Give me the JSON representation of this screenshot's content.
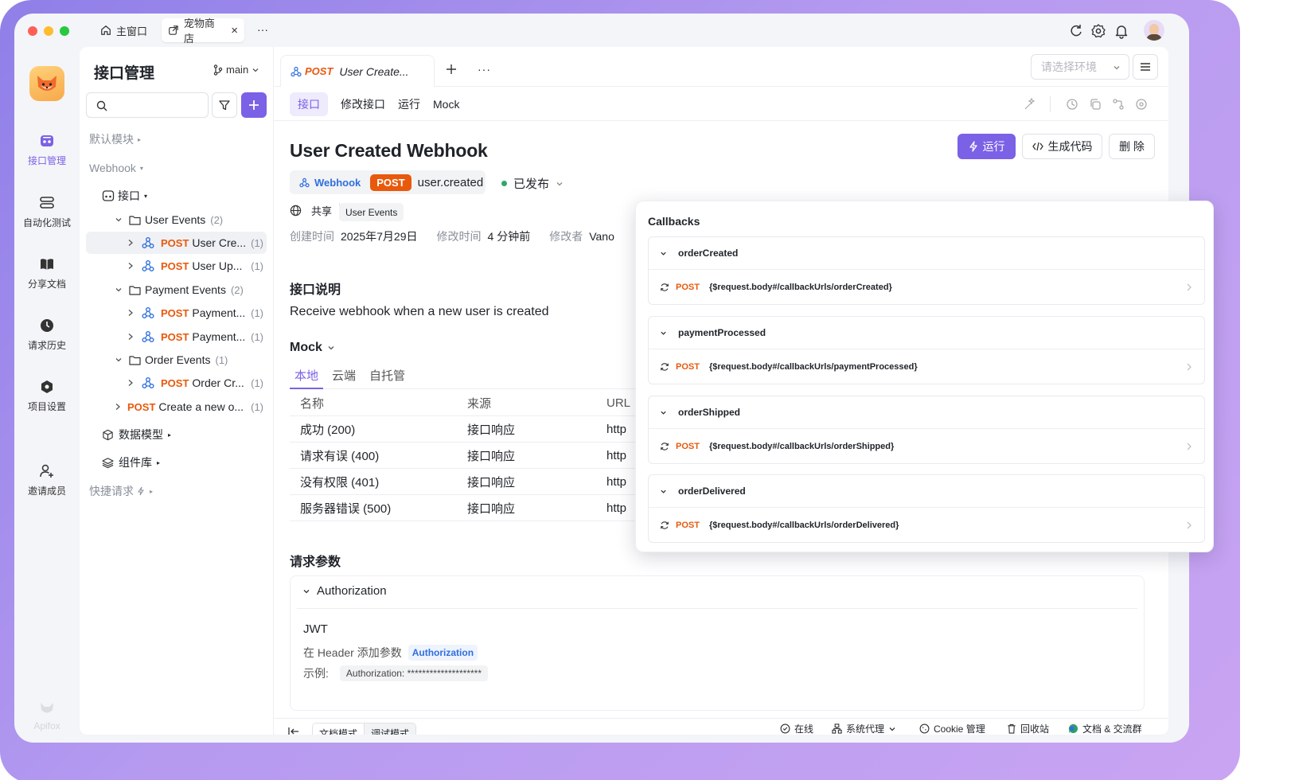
{
  "titlebar": {
    "tabs": [
      {
        "label": "主窗口",
        "icon": "home-icon"
      },
      {
        "label": "宠物商店",
        "icon": "external-link-icon",
        "close": "×"
      }
    ],
    "more": "···"
  },
  "rail": {
    "items": [
      {
        "label": "接口管理",
        "icon": "api-icon",
        "active": true
      },
      {
        "label": "自动化测试",
        "icon": "automation-icon"
      },
      {
        "label": "分享文档",
        "icon": "book-icon"
      },
      {
        "label": "请求历史",
        "icon": "clock-icon"
      },
      {
        "label": "项目设置",
        "icon": "settings-hex-icon"
      },
      {
        "label": "邀请成员",
        "icon": "add-user-icon"
      }
    ],
    "brand": "Apifox"
  },
  "sidebar": {
    "title": "接口管理",
    "branch": "main",
    "tree": {
      "default_module": "默认模块",
      "webhook": "Webhook",
      "api_folder": "接口",
      "folders": [
        {
          "name": "User Events",
          "count": "(2)",
          "items": [
            {
              "method": "POST",
              "name": "User Cre...",
              "count": "(1)"
            },
            {
              "method": "POST",
              "name": "User Up...",
              "count": "(1)"
            }
          ]
        },
        {
          "name": "Payment Events",
          "count": "(2)",
          "items": [
            {
              "method": "POST",
              "name": "Payment...",
              "count": "(1)"
            },
            {
              "method": "POST",
              "name": "Payment...",
              "count": "(1)"
            }
          ]
        },
        {
          "name": "Order Events",
          "count": "(1)",
          "items": [
            {
              "method": "POST",
              "name": "Order Cr...",
              "count": "(1)"
            }
          ]
        }
      ],
      "loose_item": {
        "method": "POST",
        "name": "Create a new o...",
        "count": "(1)"
      },
      "data_models": "数据模型",
      "components": "组件库",
      "quick_requests": "快捷请求"
    }
  },
  "main": {
    "tab": {
      "method": "POST",
      "title": "User Create..."
    },
    "env_placeholder": "请选择环境",
    "subtabs": [
      "接口",
      "修改接口",
      "运行",
      "Mock"
    ],
    "title": "User Created Webhook",
    "type_badge": "Webhook",
    "method": "POST",
    "event": "user.created",
    "status": "已发布",
    "share": "共享",
    "tag": "User Events",
    "meta": {
      "created_label": "创建时间",
      "created_value": "2025年7月29日",
      "modified_label": "修改时间",
      "modified_value": "4 分钟前",
      "modifier_label": "修改者",
      "modifier_value": "Vano"
    },
    "buttons": {
      "run": "运行",
      "gen_code": "生成代码",
      "delete": "删 除"
    },
    "desc_heading": "接口说明",
    "desc": "Receive webhook when a new user is created",
    "mock": {
      "heading": "Mock",
      "tabs": [
        "本地",
        "云端",
        "自托管"
      ],
      "headers": [
        "名称",
        "来源",
        "URL"
      ],
      "rows": [
        {
          "name": "成功 (200)",
          "source": "接口响应",
          "url": "http"
        },
        {
          "name": "请求有误 (400)",
          "source": "接口响应",
          "url": "http"
        },
        {
          "name": "没有权限 (401)",
          "source": "接口响应",
          "url": "http"
        },
        {
          "name": "服务器错误 (500)",
          "source": "接口响应",
          "url": "http"
        }
      ]
    },
    "params_heading": "请求参数",
    "auth": {
      "title": "Authorization",
      "type": "JWT",
      "header_text": "在 Header 添加参数",
      "header_key": "Authorization",
      "example_label": "示例:",
      "example_value": "Authorization: ********************"
    }
  },
  "callbacks": {
    "title": "Callbacks",
    "items": [
      {
        "name": "orderCreated",
        "method": "POST",
        "url": "{$request.body#/callbackUrls/orderCreated}"
      },
      {
        "name": "paymentProcessed",
        "method": "POST",
        "url": "{$request.body#/callbackUrls/paymentProcessed}"
      },
      {
        "name": "orderShipped",
        "method": "POST",
        "url": "{$request.body#/callbackUrls/orderShipped}"
      },
      {
        "name": "orderDelivered",
        "method": "POST",
        "url": "{$request.body#/callbackUrls/orderDelivered}"
      }
    ]
  },
  "statusbar": {
    "doc_mode": "文档模式",
    "debug_mode": "调试模式",
    "online": "在线",
    "proxy": "系统代理",
    "cookie": "Cookie 管理",
    "trash": "回收站",
    "docs": "文档 & 交流群"
  },
  "colors": {
    "accent": "#7b61e6",
    "post": "#e8590c",
    "published": "#2ea86b",
    "link": "#2f6fde"
  }
}
